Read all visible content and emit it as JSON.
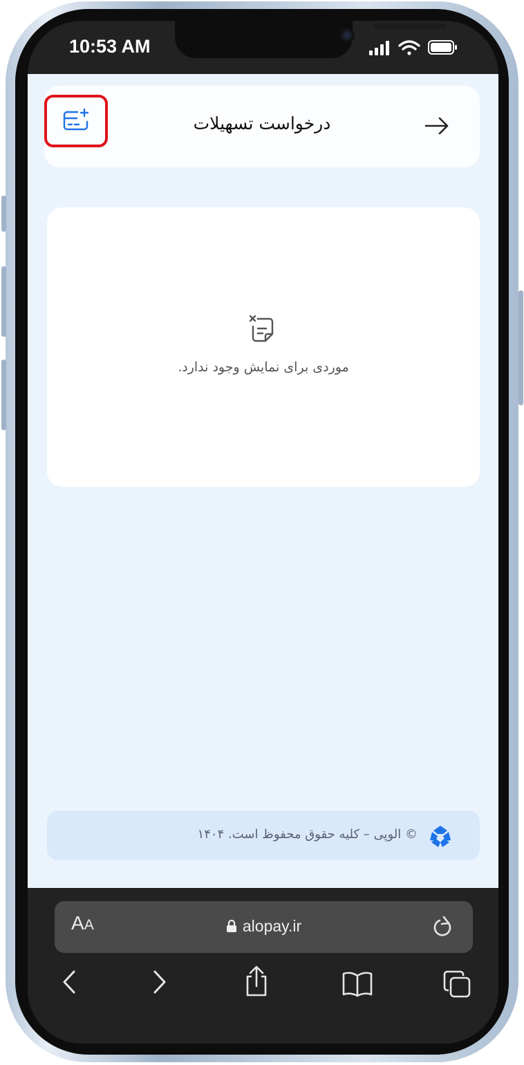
{
  "status_bar": {
    "time": "10:53 AM"
  },
  "header": {
    "title": "درخواست تسهیلات"
  },
  "empty_state": {
    "message": "موردی برای نمایش وجود ندارد."
  },
  "footer": {
    "copyright": "© الوپی – کلیه حقوق محفوظ است. ۱۴۰۴"
  },
  "browser": {
    "aa_label": "A",
    "aa_small": "A",
    "url": "alopay.ir"
  },
  "colors": {
    "accent": "#1e73e8",
    "highlight": "#e0131b",
    "page_bg": "#ebf4fd"
  },
  "icons": {
    "back": "arrow-right-icon",
    "add": "card-plus-icon",
    "empty": "note-x-icon",
    "logo": "alopay-logo-icon"
  }
}
